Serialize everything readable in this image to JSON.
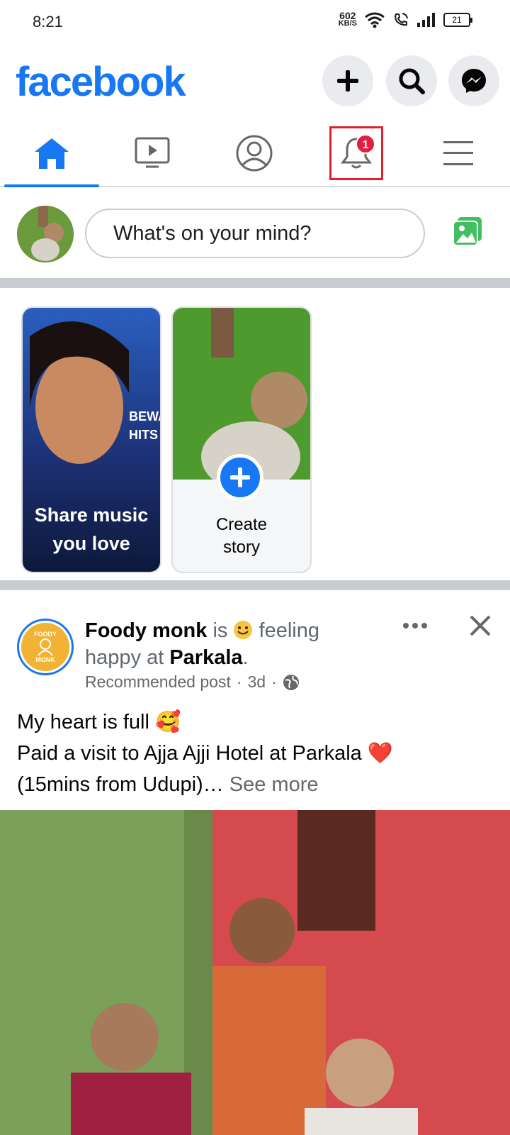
{
  "status_bar": {
    "time": "8:21",
    "net_speed_value": "602",
    "net_speed_unit": "KB/S",
    "battery": "21"
  },
  "header": {
    "logo": "facebook",
    "brand_color": "#1877f2"
  },
  "tabs": [
    {
      "name": "home",
      "icon": "home-icon",
      "active": true
    },
    {
      "name": "watch",
      "icon": "video-icon",
      "active": false
    },
    {
      "name": "profile",
      "icon": "profile-icon",
      "active": false
    },
    {
      "name": "notifications",
      "icon": "bell-icon",
      "active": false,
      "badge": "1"
    },
    {
      "name": "menu",
      "icon": "hamburger-icon",
      "active": false
    }
  ],
  "composer": {
    "placeholder": "What's on your mind?"
  },
  "stories": [
    {
      "label": "Share music you love",
      "line1": "Share music",
      "line2": "you love",
      "poster_text": "BEWA HITS"
    },
    {
      "label": "Create story",
      "line1": "Create",
      "line2": "story"
    }
  ],
  "post": {
    "author": "Foody monk",
    "verb": "is",
    "feeling": "feeling happy at",
    "feeling_line1": "feeling",
    "feeling_line2": "happy at",
    "place": "Parkala",
    "meta": "Recommended post",
    "time_ago": "3d",
    "text_line1": "My heart is full 🥰",
    "text_line2": "Paid a visit to Ajja Ajji Hotel at Parkala ❤️",
    "text_line3": "(15mins from Udupi)…",
    "see_more": "See more",
    "avatar_text_top": "FOODY",
    "avatar_text_bottom": "MONK"
  },
  "colors": {
    "notif_highlight": "#e41e2b",
    "badge": "#e41e3f",
    "divider": "#c9ccd1"
  }
}
